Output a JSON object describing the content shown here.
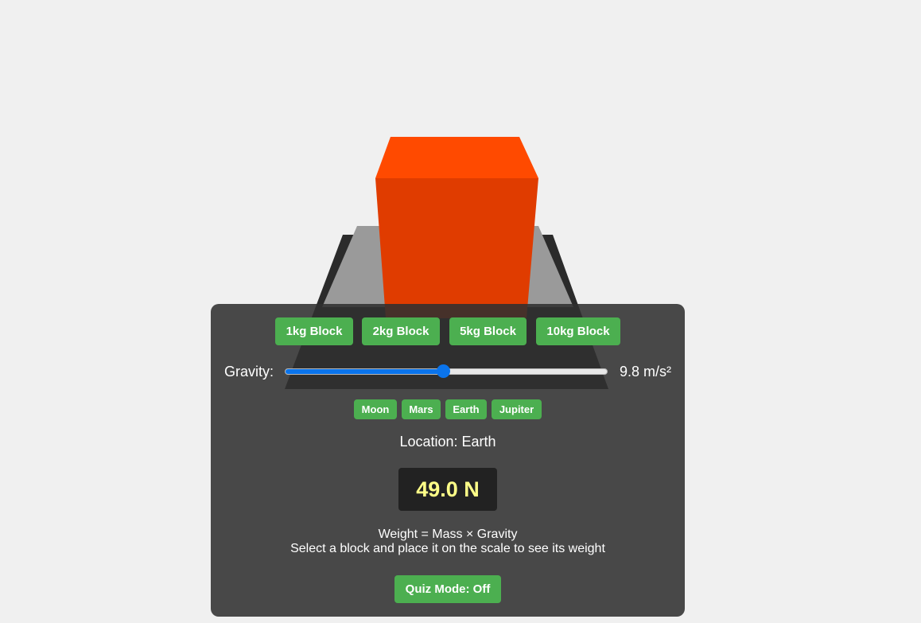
{
  "colors": {
    "background": "#f0f0f0",
    "panel": "#303030",
    "button": "#4caf50",
    "slider_accent": "#0a74ec",
    "readout_text": "#ffff88",
    "block": "#e03c00",
    "block_top": "#ff4a00"
  },
  "blocks": [
    {
      "label": "1kg Block"
    },
    {
      "label": "2kg Block"
    },
    {
      "label": "5kg Block"
    },
    {
      "label": "10kg Block"
    }
  ],
  "gravity": {
    "label": "Gravity:",
    "value_text": "9.8 m/s²",
    "slider_fraction": 0.49
  },
  "planets": [
    {
      "label": "Moon"
    },
    {
      "label": "Mars"
    },
    {
      "label": "Earth"
    },
    {
      "label": "Jupiter"
    }
  ],
  "location_text": "Location: Earth",
  "weight_readout": "49.0 N",
  "formula_text": "Weight = Mass × Gravity",
  "instructions_text": "Select a block and place it on the scale to see its weight",
  "quiz_button_label": "Quiz Mode: Off"
}
